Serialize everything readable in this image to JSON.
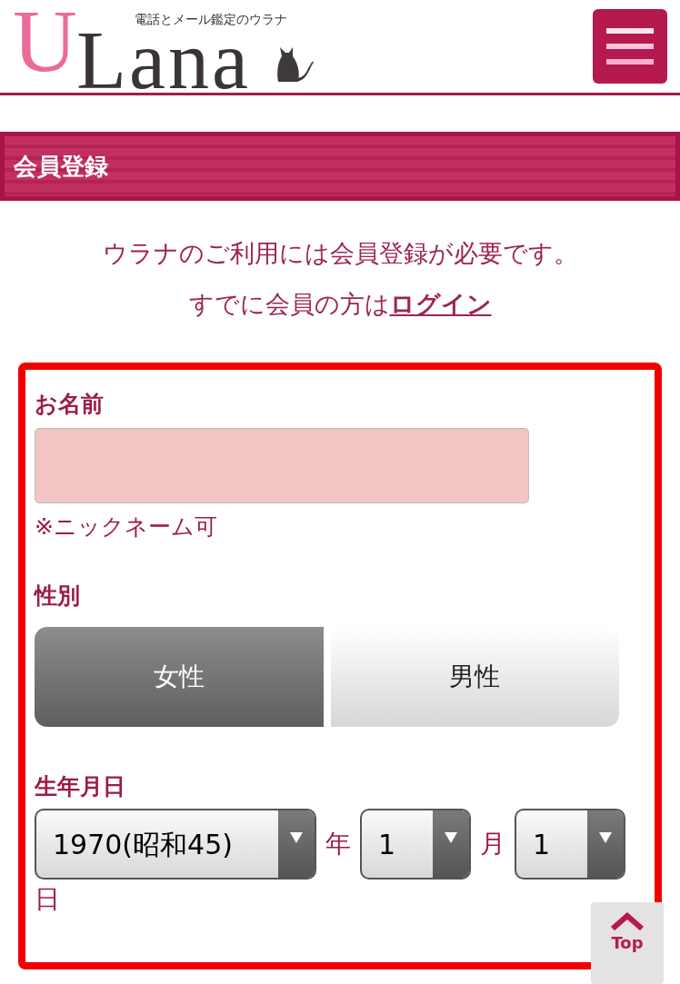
{
  "header": {
    "logo": {
      "initial": "U",
      "rest": "Lana"
    },
    "tagline": "電話とメール鑑定のウラナ"
  },
  "section_title": "会員登録",
  "intro": {
    "line_1": "ウラナのご利用には会員登録が必要です。",
    "line_2": "すでに会員の方は",
    "login_link": "ログイン"
  },
  "form": {
    "name": {
      "label": "お名前",
      "note": "※ニックネーム可"
    },
    "gender": {
      "label": "性別",
      "options": [
        {
          "label": "女性",
          "selected": true
        },
        {
          "label": "男性",
          "selected": false
        }
      ]
    },
    "birthdate": {
      "label": "生年月日",
      "parts": [
        {
          "value": "1970(昭和45)",
          "unit": "年"
        },
        {
          "value": "1",
          "unit": "月"
        },
        {
          "value": "1",
          "unit": "日"
        }
      ]
    }
  },
  "top_button": "Top"
}
